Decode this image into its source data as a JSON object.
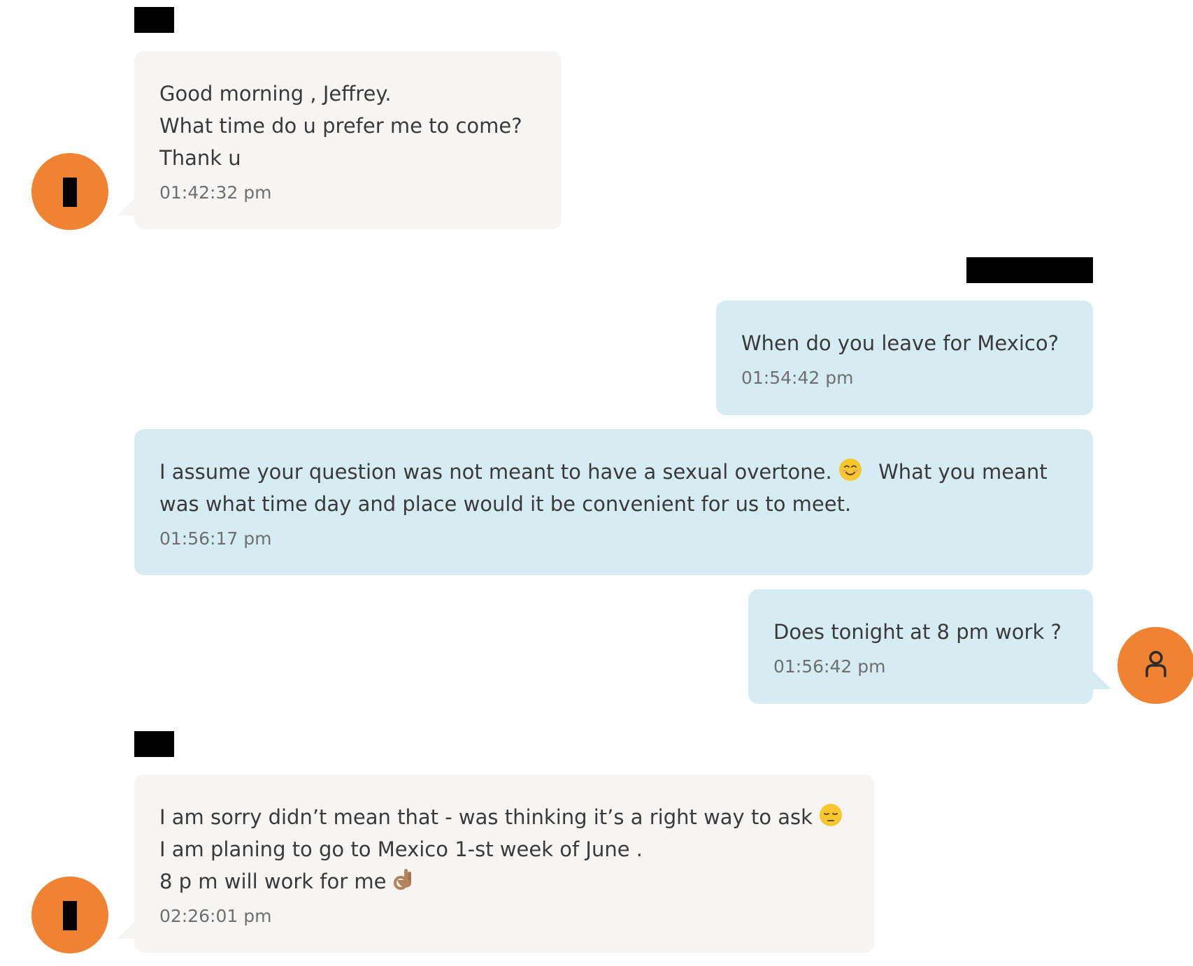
{
  "messages": [
    {
      "direction": "incoming",
      "lines": [
        "Good morning , Jeffrey.",
        "What time do u prefer me to come?",
        "Thank u"
      ],
      "time": "01:42:32 pm"
    },
    {
      "direction": "outgoing",
      "lines": [
        "When do you leave for Mexico?"
      ],
      "time": "01:54:42 pm"
    },
    {
      "direction": "outgoing",
      "lines": [
        "I assume your question was not meant to have a sexual overtone.",
        "What you meant",
        "was what time day and place would it be convenient for us to meet."
      ],
      "time": "01:56:17 pm"
    },
    {
      "direction": "outgoing",
      "lines": [
        "Does tonight at 8 pm work ?"
      ],
      "time": "01:56:42 pm"
    },
    {
      "direction": "incoming",
      "lines": [
        "I am sorry didn’t mean that - was thinking it’s a right way to ask",
        "I am planing to go to Mexico 1-st week of June .",
        "8 p m will work for me"
      ],
      "time": "02:26:01 pm"
    }
  ],
  "icons": {
    "smile": "smiling-face-emoji",
    "pensive": "pensive-face-emoji",
    "ok_hand": "ok-hand-emoji",
    "user": "user-icon"
  },
  "colors": {
    "avatar": "#f08332",
    "incoming_bubble": "#f6f5f4",
    "outgoing_bubble": "#d6ecf3"
  }
}
